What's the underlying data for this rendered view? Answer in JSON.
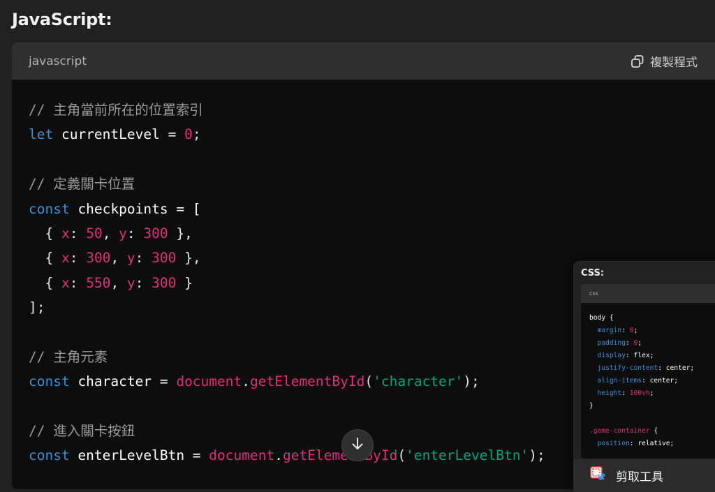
{
  "heading": "JavaScript:",
  "code_block": {
    "language": "javascript",
    "copy_label": "複製程式",
    "lines": [
      [
        {
          "t": "// 主角當前所在的位置索引",
          "c": "comment"
        }
      ],
      [
        {
          "t": "let",
          "c": "keyword"
        },
        {
          "t": " currentLevel = ",
          "c": "var"
        },
        {
          "t": "0",
          "c": "num"
        },
        {
          "t": ";",
          "c": "punc"
        }
      ],
      [],
      [
        {
          "t": "// 定義關卡位置",
          "c": "comment"
        }
      ],
      [
        {
          "t": "const",
          "c": "keyword"
        },
        {
          "t": " checkpoints = [",
          "c": "var"
        }
      ],
      [
        {
          "t": "  { ",
          "c": "punc"
        },
        {
          "t": "x",
          "c": "prop"
        },
        {
          "t": ": ",
          "c": "punc"
        },
        {
          "t": "50",
          "c": "num"
        },
        {
          "t": ", ",
          "c": "punc"
        },
        {
          "t": "y",
          "c": "prop"
        },
        {
          "t": ": ",
          "c": "punc"
        },
        {
          "t": "300",
          "c": "num"
        },
        {
          "t": " },",
          "c": "punc"
        }
      ],
      [
        {
          "t": "  { ",
          "c": "punc"
        },
        {
          "t": "x",
          "c": "prop"
        },
        {
          "t": ": ",
          "c": "punc"
        },
        {
          "t": "300",
          "c": "num"
        },
        {
          "t": ", ",
          "c": "punc"
        },
        {
          "t": "y",
          "c": "prop"
        },
        {
          "t": ": ",
          "c": "punc"
        },
        {
          "t": "300",
          "c": "num"
        },
        {
          "t": " },",
          "c": "punc"
        }
      ],
      [
        {
          "t": "  { ",
          "c": "punc"
        },
        {
          "t": "x",
          "c": "prop"
        },
        {
          "t": ": ",
          "c": "punc"
        },
        {
          "t": "550",
          "c": "num"
        },
        {
          "t": ", ",
          "c": "punc"
        },
        {
          "t": "y",
          "c": "prop"
        },
        {
          "t": ": ",
          "c": "punc"
        },
        {
          "t": "300",
          "c": "num"
        },
        {
          "t": " }",
          "c": "punc"
        }
      ],
      [
        {
          "t": "];",
          "c": "punc"
        }
      ],
      [],
      [
        {
          "t": "// 主角元素",
          "c": "comment"
        }
      ],
      [
        {
          "t": "const",
          "c": "keyword"
        },
        {
          "t": " character = ",
          "c": "var"
        },
        {
          "t": "document",
          "c": "obj"
        },
        {
          "t": ".",
          "c": "punc"
        },
        {
          "t": "getElementById",
          "c": "method"
        },
        {
          "t": "(",
          "c": "punc"
        },
        {
          "t": "'character'",
          "c": "str"
        },
        {
          "t": ");",
          "c": "punc"
        }
      ],
      [],
      [
        {
          "t": "// 進入關卡按鈕",
          "c": "comment"
        }
      ],
      [
        {
          "t": "const",
          "c": "keyword"
        },
        {
          "t": " enterLevelBtn = ",
          "c": "var"
        },
        {
          "t": "document",
          "c": "obj"
        },
        {
          "t": ".",
          "c": "punc"
        },
        {
          "t": "getElementById",
          "c": "method"
        },
        {
          "t": "(",
          "c": "punc"
        },
        {
          "t": "'enterLevelBtn'",
          "c": "str"
        },
        {
          "t": ");",
          "c": "punc"
        }
      ]
    ]
  },
  "mini_preview": {
    "title": "CSS:",
    "language": "css",
    "lines": [
      [
        {
          "t": "body {",
          "c": "sel"
        }
      ],
      [
        {
          "t": "  margin",
          "c": "prop"
        },
        {
          "t": ": ",
          "c": "sel"
        },
        {
          "t": "0",
          "c": "num"
        },
        {
          "t": ";",
          "c": "sel"
        }
      ],
      [
        {
          "t": "  padding",
          "c": "prop"
        },
        {
          "t": ": ",
          "c": "sel"
        },
        {
          "t": "0",
          "c": "num"
        },
        {
          "t": ";",
          "c": "sel"
        }
      ],
      [
        {
          "t": "  display",
          "c": "prop"
        },
        {
          "t": ": flex;",
          "c": "sel"
        }
      ],
      [
        {
          "t": "  justify-content",
          "c": "prop"
        },
        {
          "t": ": center;",
          "c": "sel"
        }
      ],
      [
        {
          "t": "  align-items",
          "c": "prop"
        },
        {
          "t": ": center;",
          "c": "sel"
        }
      ],
      [
        {
          "t": "  height",
          "c": "prop"
        },
        {
          "t": ": ",
          "c": "sel"
        },
        {
          "t": "100vh",
          "c": "num"
        },
        {
          "t": ";",
          "c": "sel"
        }
      ],
      [
        {
          "t": "}",
          "c": "sel"
        }
      ],
      [],
      [
        {
          "t": ".game-container",
          "c": "sel2"
        },
        {
          "t": " {",
          "c": "sel"
        }
      ],
      [
        {
          "t": "  position",
          "c": "prop"
        },
        {
          "t": ": relative;",
          "c": "sel"
        }
      ]
    ]
  },
  "snip_tool": {
    "label": "剪取工具",
    "icon": "snipping-tool-icon"
  },
  "icons": {
    "copy": "copy-icon",
    "scroll_down": "arrow-down-icon"
  }
}
